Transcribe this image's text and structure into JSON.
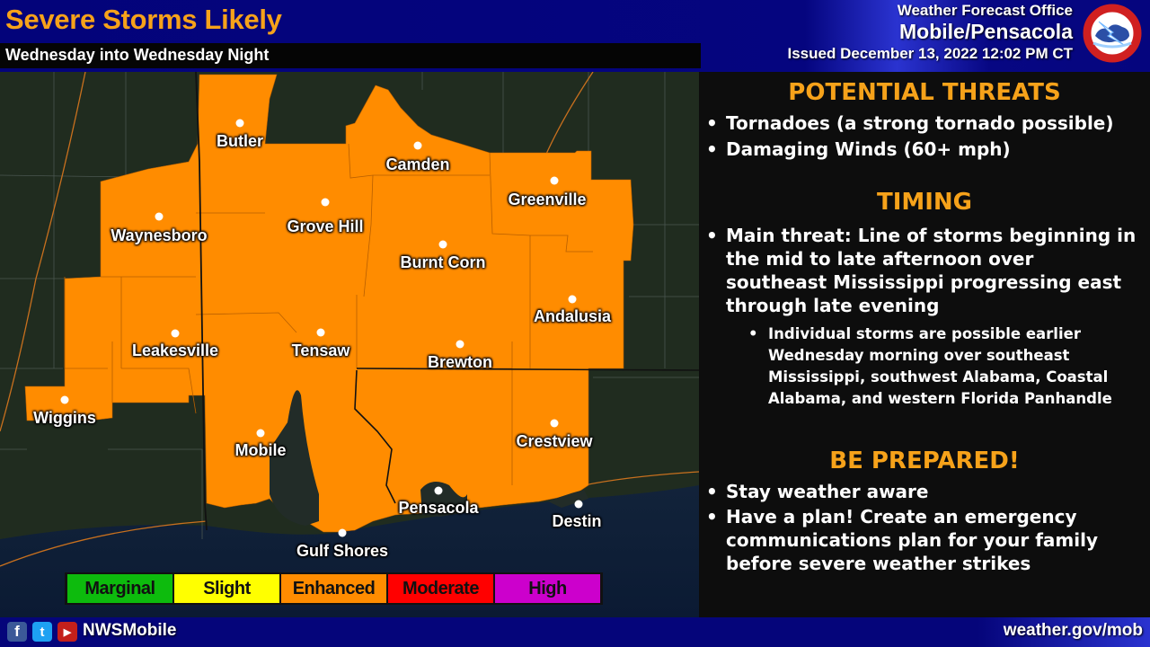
{
  "header": {
    "title": "Severe Storms Likely",
    "subtitle": "Wednesday into Wednesday Night",
    "office_line1": "Weather Forecast Office",
    "office_line2": "Mobile/Pensacola",
    "issued": "Issued December 13, 2022 12:02 PM CT",
    "logo_icon": "nws-logo-icon"
  },
  "map": {
    "risk_level": "Enhanced",
    "risk_color": "#ff8c00",
    "cities": [
      {
        "name": "Butler"
      },
      {
        "name": "Camden"
      },
      {
        "name": "Greenville"
      },
      {
        "name": "Waynesboro"
      },
      {
        "name": "Grove Hill"
      },
      {
        "name": "Burnt Corn"
      },
      {
        "name": "Andalusia"
      },
      {
        "name": "Leakesville"
      },
      {
        "name": "Tensaw"
      },
      {
        "name": "Brewton"
      },
      {
        "name": "Wiggins"
      },
      {
        "name": "Mobile"
      },
      {
        "name": "Crestview"
      },
      {
        "name": "Pensacola"
      },
      {
        "name": "Destin"
      },
      {
        "name": "Gulf Shores"
      }
    ]
  },
  "legend": [
    {
      "label": "Marginal",
      "color": "#0dbb0d"
    },
    {
      "label": "Slight",
      "color": "#ffff00"
    },
    {
      "label": "Enhanced",
      "color": "#ff8c00"
    },
    {
      "label": "Moderate",
      "color": "#ff0000"
    },
    {
      "label": "High",
      "color": "#cc00cc"
    }
  ],
  "panel": {
    "threats_heading": "POTENTIAL THREATS",
    "threats": [
      "Tornadoes (a strong tornado possible)",
      "Damaging Winds (60+ mph)"
    ],
    "timing_heading": "TIMING",
    "timing": [
      "Main threat: Line of storms beginning in the mid to late afternoon over southeast Mississippi progressing east through late evening"
    ],
    "timing_sub": [
      "Individual storms are possible earlier Wednesday morning over southeast Mississippi, southwest Alabama, Coastal Alabama, and western Florida Panhandle"
    ],
    "prepared_heading": "BE PREPARED!",
    "prepared": [
      "Stay weather aware",
      "Have a plan! Create an emergency communications plan for your family before severe weather strikes"
    ],
    "bullet": "•"
  },
  "footer": {
    "facebook_icon": "f",
    "twitter_icon": "t",
    "youtube_icon": "▶",
    "handle": "NWSMobile",
    "url": "weather.gov/mob"
  }
}
